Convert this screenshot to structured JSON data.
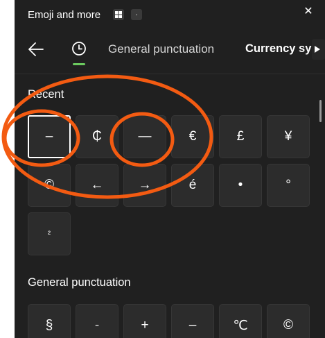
{
  "window": {
    "title": "Emoji and more",
    "shortcut_dot": ".",
    "close_glyph": "✕"
  },
  "nav": {
    "back_icon": "arrow-left-icon",
    "recent_icon": "clock-icon",
    "recent_indicator_color": "#6ccb5f",
    "tabs": [
      {
        "label": "General punctuation"
      },
      {
        "label": "Currency syml"
      }
    ],
    "scroll_right_icon": "triangle-right-icon"
  },
  "recent": {
    "heading": "Recent",
    "symbols": [
      "–",
      "₵",
      "—",
      "€",
      "£",
      "¥",
      "©",
      "←",
      "→",
      "é",
      "•",
      "°",
      "²"
    ]
  },
  "general": {
    "heading": "General punctuation",
    "symbols": [
      "§",
      "-",
      "+",
      "–",
      "℃",
      "©"
    ]
  },
  "annotation": {
    "color": "#f35b12"
  }
}
